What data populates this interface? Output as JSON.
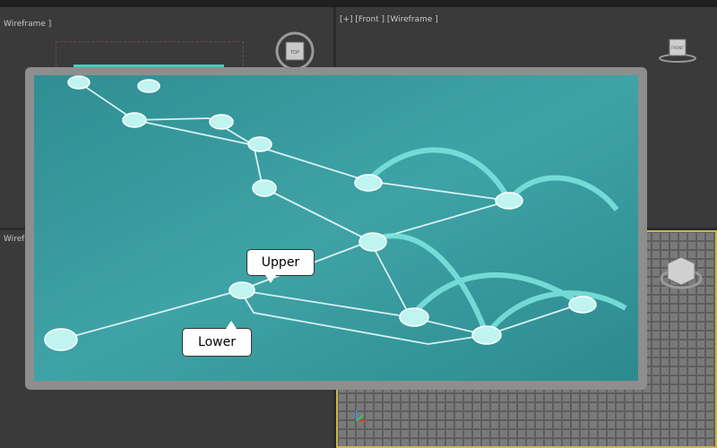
{
  "viewports": {
    "top": {
      "label": "Wireframe ]"
    },
    "front": {
      "label": "[+] [Front ] [Wireframe ]"
    },
    "left": {
      "label": "Wireframe ]"
    },
    "perspective": {
      "label": ""
    }
  },
  "navcubes": {
    "top": {
      "face": "TOP"
    },
    "front": {
      "face": "FRONT"
    }
  },
  "overlay": {
    "callouts": {
      "upper": "Upper",
      "lower": "Lower"
    }
  },
  "colors": {
    "accent_water": "#3f9ea0",
    "viewport_bg": "#3a3a3a",
    "active_border": "#c9b74a",
    "highlight": "#3fd1c0"
  }
}
